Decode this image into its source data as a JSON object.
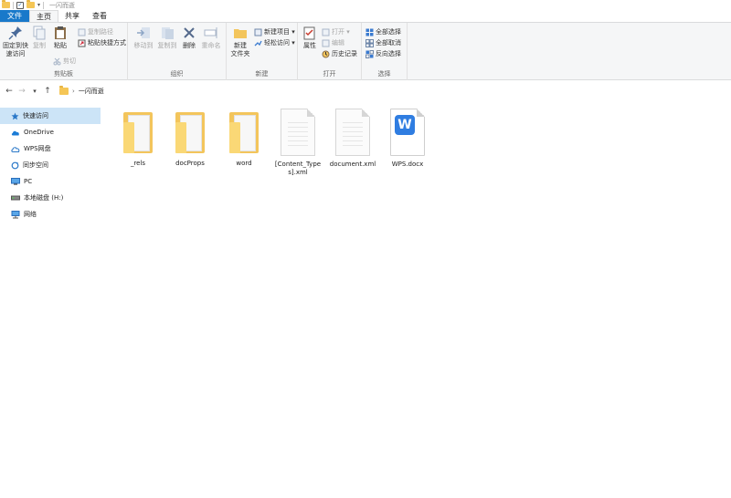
{
  "window": {
    "title": "一闪而逝"
  },
  "tabs": [
    "文件",
    "主页",
    "共享",
    "查看"
  ],
  "ribbon": {
    "clipboard": {
      "pin_label_1": "固定到快",
      "pin_label_2": "速访问",
      "copy": "复制",
      "paste": "粘贴",
      "copy_path": "复制路径",
      "paste_shortcut": "粘贴快捷方式",
      "cut": "剪切",
      "group": "剪贴板"
    },
    "organize": {
      "move_to": "移动到",
      "copy_to": "复制到",
      "delete": "删除",
      "rename": "重命名",
      "group": "组织"
    },
    "new": {
      "new_folder_1": "新建",
      "new_folder_2": "文件夹",
      "new_item": "新建项目 ▾",
      "easy_access": "轻松访问 ▾",
      "group": "新建"
    },
    "open": {
      "properties": "属性",
      "open": "打开 ▾",
      "edit": "编辑",
      "history": "历史记录",
      "group": "打开"
    },
    "select": {
      "select_all": "全部选择",
      "select_none": "全部取消",
      "invert": "反向选择",
      "group": "选择"
    }
  },
  "address": {
    "path": "一闪而逝"
  },
  "sidebar": [
    {
      "label": "快速访问",
      "icon": "star-pin-icon"
    },
    {
      "label": "OneDrive",
      "icon": "cloud-icon"
    },
    {
      "label": "WPS网盘",
      "icon": "wps-cloud-icon"
    },
    {
      "label": "同步空间",
      "icon": "sync-icon"
    },
    {
      "label": "PC",
      "icon": "pc-icon"
    },
    {
      "label": "本地磁盘 (H:)",
      "icon": "drive-icon"
    },
    {
      "label": "网络",
      "icon": "network-icon"
    }
  ],
  "files": [
    {
      "name": "_rels",
      "type": "folder"
    },
    {
      "name": "docProps",
      "type": "folder"
    },
    {
      "name": "word",
      "type": "folder"
    },
    {
      "name": "[Content_Types].xml",
      "type": "xml"
    },
    {
      "name": "document.xml",
      "type": "xml"
    },
    {
      "name": "WPS.docx",
      "type": "docx"
    }
  ],
  "colors": {
    "accent": "#1979ca",
    "folder": "#f3c55c",
    "selected": "#cce4f7",
    "wps": "#2f7de1"
  }
}
